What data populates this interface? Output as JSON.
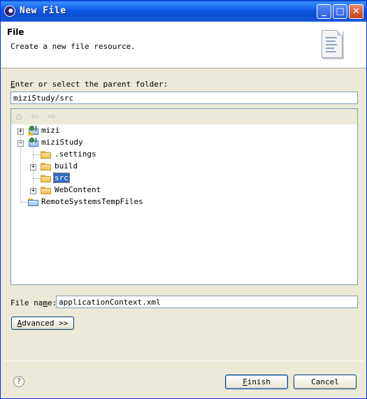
{
  "window": {
    "title": "New File",
    "controls": {
      "minimize": "_",
      "maximize": "□",
      "close": "✕"
    }
  },
  "header": {
    "title": "File",
    "description": "Create a new file resource.",
    "icon": "new-file-wizard-icon"
  },
  "parent_folder": {
    "label_prefix": "E",
    "label_rest": "nter or select the parent folder:",
    "value": "miziStudy/src"
  },
  "tree": {
    "toolbar": {
      "home_icon": "⌂",
      "back_icon": "⇦",
      "forward_icon": "⇨"
    },
    "items": [
      {
        "label": "mizi",
        "expander": "+"
      },
      {
        "label": "miziStudy",
        "expander": "−"
      },
      {
        "label": ".settings"
      },
      {
        "label": "build",
        "expander": "+"
      },
      {
        "label": "src",
        "selected": true
      },
      {
        "label": "WebContent",
        "expander": "+"
      },
      {
        "label": "RemoteSystemsTempFiles"
      }
    ]
  },
  "file_name": {
    "label_before": "File na",
    "label_mnemonic": "m",
    "label_after": "e:",
    "value": "applicationContext.xml"
  },
  "buttons": {
    "advanced_mnemonic": "A",
    "advanced_rest": "dvanced >>",
    "help": "?",
    "finish_mnemonic": "F",
    "finish_rest": "inish",
    "cancel": "Cancel"
  },
  "colors": {
    "titlebar": "#0b4fd0",
    "selection": "#316ac5",
    "dialog_bg": "#ece9d8"
  }
}
